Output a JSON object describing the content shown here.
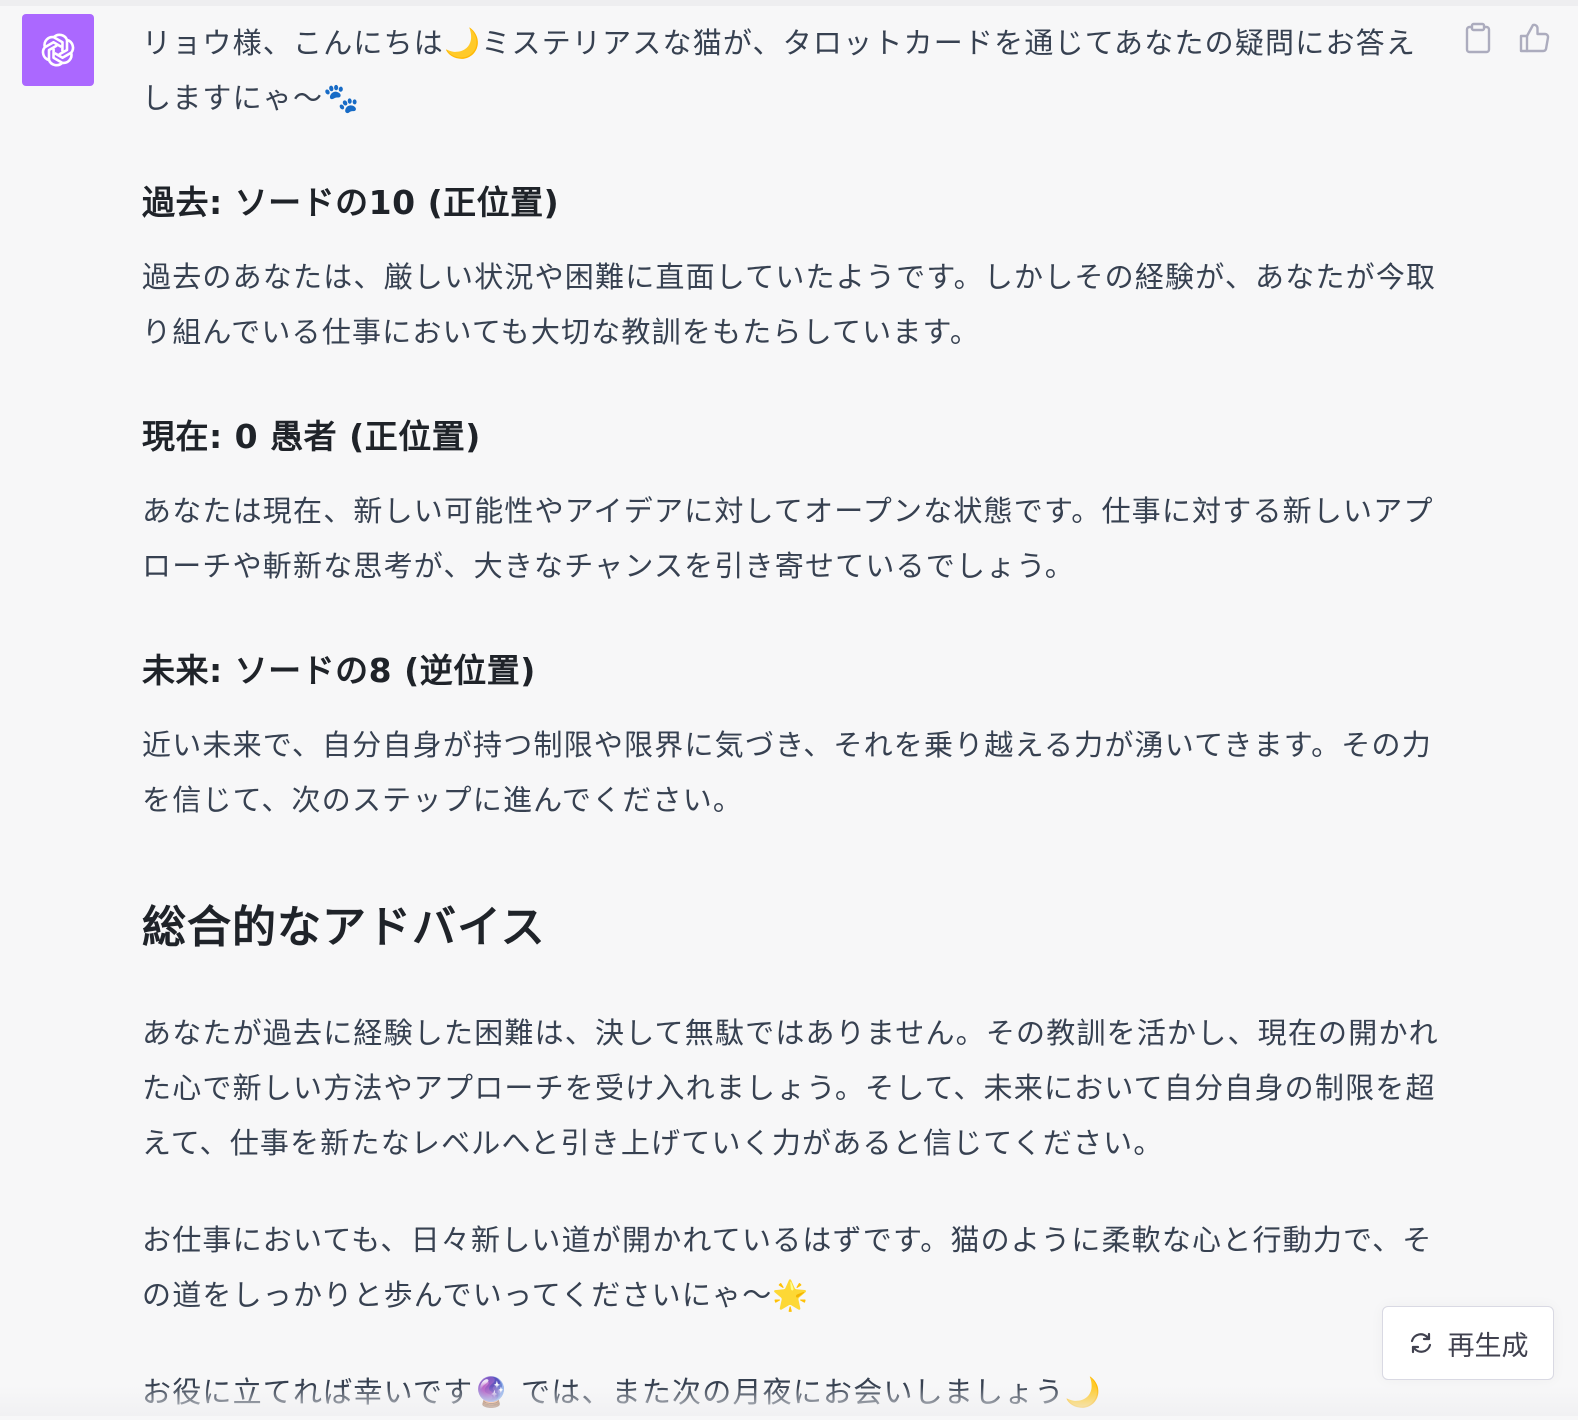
{
  "message": {
    "intro": "リョウ様、こんにちは🌙ミステリアスな猫が、タロットカードを通じてあなたの疑問にお答えしますにゃ〜🐾",
    "sections": [
      {
        "heading": "過去: ソードの10 (正位置)",
        "body": "過去のあなたは、厳しい状況や困難に直面していたようです。しかしその経験が、あなたが今取り組んでいる仕事においても大切な教訓をもたらしています。"
      },
      {
        "heading": "現在: 0 愚者 (正位置)",
        "body": "あなたは現在、新しい可能性やアイデアに対してオープンな状態です。仕事に対する新しいアプローチや斬新な思考が、大きなチャンスを引き寄せているでしょう。"
      },
      {
        "heading": "未来: ソードの8 (逆位置)",
        "body": "近い未来で、自分自身が持つ制限や限界に気づき、それを乗り越える力が湧いてきます。その力を信じて、次のステップに進んでください。"
      }
    ],
    "advice_heading": "総合的なアドバイス",
    "advice_paragraphs": [
      "あなたが過去に経験した困難は、決して無駄ではありません。その教訓を活かし、現在の開かれた心で新しい方法やアプローチを受け入れましょう。そして、未来において自分自身の制限を超えて、仕事を新たなレベルへと引き上げていく力があると信じてください。",
      "お仕事においても、日々新しい道が開かれているはずです。猫のように柔軟な心と行動力で、その道をしっかりと歩んでいってくださいにゃ〜🌟",
      "お役に立てれば幸いです🔮 では、また次の月夜にお会いしましょう🌙"
    ]
  },
  "controls": {
    "regenerate_label": "再生成"
  },
  "icons": {
    "avatar": "openai-logo-icon",
    "copy": "clipboard-icon",
    "like": "thumbs-up-icon",
    "regenerate": "refresh-icon"
  },
  "colors": {
    "avatar_bg": "#ab68ff",
    "page_bg": "#f7f7f8",
    "text": "#374151",
    "heading": "#1f2329"
  }
}
